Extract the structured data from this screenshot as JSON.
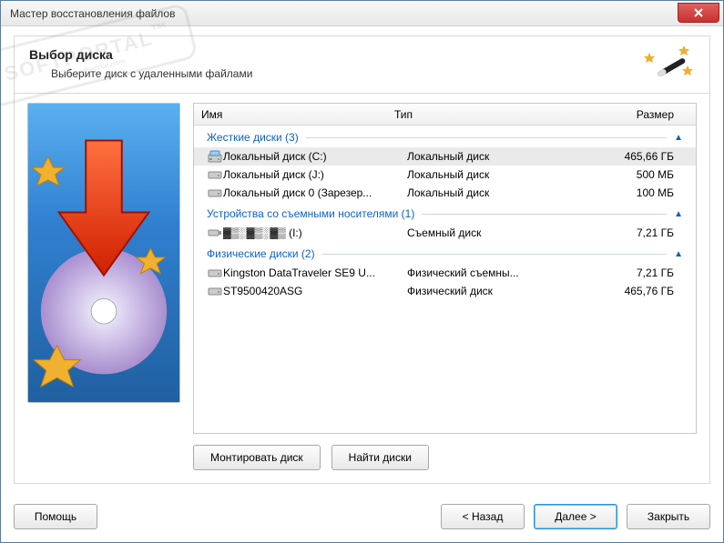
{
  "window": {
    "title": "Мастер восстановления файлов"
  },
  "header": {
    "title": "Выбор диска",
    "subtitle": "Выберите диск с удаленными файлами"
  },
  "columns": {
    "name": "Имя",
    "type": "Тип",
    "size": "Размер"
  },
  "groups": [
    {
      "label": "Жесткие диски (3)",
      "items": [
        {
          "name": "Локальный диск (C:)",
          "type": "Локальный диск",
          "size": "465,66 ГБ",
          "selected": true,
          "icon": "primary"
        },
        {
          "name": "Локальный диск (J:)",
          "type": "Локальный диск",
          "size": "500 МБ",
          "selected": false,
          "icon": "hdd"
        },
        {
          "name": "Локальный диск 0 (Зарезер...",
          "type": "Локальный диск",
          "size": "100 МБ",
          "selected": false,
          "icon": "hdd"
        }
      ]
    },
    {
      "label": "Устройства со съемными носителями (1)",
      "items": [
        {
          "name": "▓▒░▓▒░▓▒ (I:)",
          "type": "Съемный диск",
          "size": "7,21 ГБ",
          "selected": false,
          "icon": "usb"
        }
      ]
    },
    {
      "label": "Физические диски (2)",
      "items": [
        {
          "name": "Kingston DataTraveler SE9 U...",
          "type": "Физический съемны...",
          "size": "7,21 ГБ",
          "selected": false,
          "icon": "hdd"
        },
        {
          "name": "ST9500420ASG",
          "type": "Физический диск",
          "size": "465,76 ГБ",
          "selected": false,
          "icon": "hdd"
        }
      ]
    }
  ],
  "buttons": {
    "mount": "Монтировать диск",
    "find": "Найти диски",
    "help": "Помощь",
    "back": "< Назад",
    "next": "Далее >",
    "close": "Закрыть"
  },
  "watermark": {
    "main": "SOFTPORTAL",
    "sub": "www.softportal.com",
    "tm": "™"
  }
}
